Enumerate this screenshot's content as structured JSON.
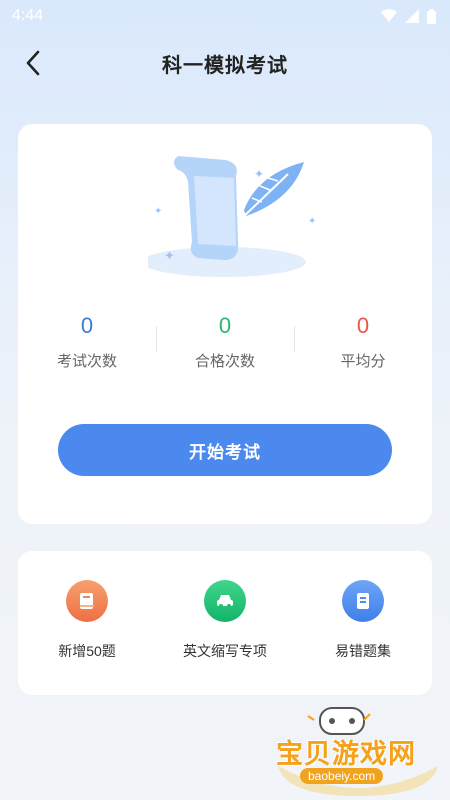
{
  "status_bar": {
    "time": "4:44",
    "icons": [
      "wifi-icon",
      "signal-icon",
      "battery-icon"
    ]
  },
  "header": {
    "title": "科一模拟考试",
    "back_icon": "chevron-left-icon"
  },
  "stats": [
    {
      "value": "0",
      "label": "考试次数",
      "color": "#3a7bd5"
    },
    {
      "value": "0",
      "label": "合格次数",
      "color": "#2bb673"
    },
    {
      "value": "0",
      "label": "平均分",
      "color": "#e8564b"
    }
  ],
  "start_button": {
    "label": "开始考试",
    "color": "#4b89ee"
  },
  "tools": [
    {
      "label": "新增50题",
      "icon": "book-icon",
      "color": "#f07a4a"
    },
    {
      "label": "英文缩写专项",
      "icon": "car-icon",
      "color": "#22c07a"
    },
    {
      "label": "易错题集",
      "icon": "note-icon",
      "color": "#4a8cf0"
    }
  ],
  "watermark": {
    "text": "宝贝游戏网",
    "url": "baobeiy.com"
  }
}
